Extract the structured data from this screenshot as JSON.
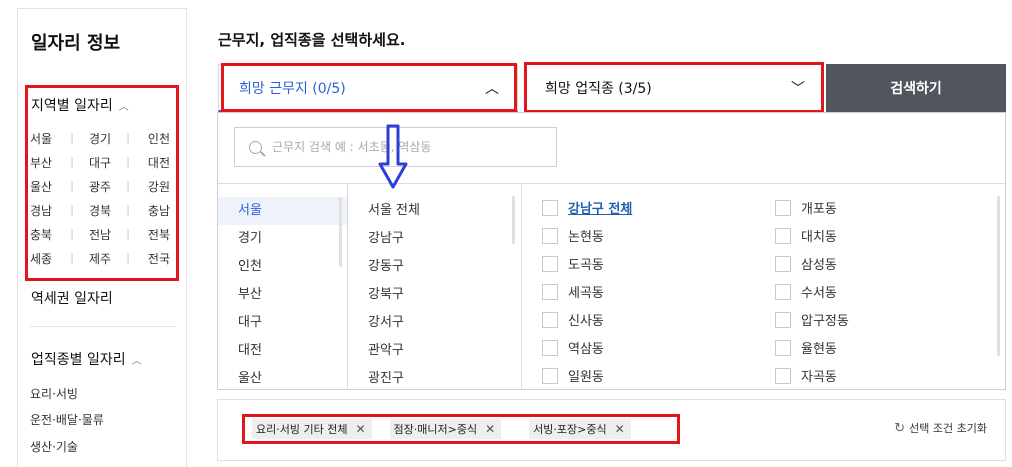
{
  "sidebar": {
    "title": "일자리 정보",
    "region_heading": "지역별 일자리",
    "regions": [
      [
        "서울",
        "경기",
        "인천"
      ],
      [
        "부산",
        "대구",
        "대전"
      ],
      [
        "울산",
        "광주",
        "강원"
      ],
      [
        "경남",
        "경북",
        "충남"
      ],
      [
        "충북",
        "전남",
        "전북"
      ],
      [
        "세종",
        "제주",
        "전국"
      ]
    ],
    "station_heading": "역세권 일자리",
    "job_heading": "업직종별 일자리",
    "job_items": [
      "요리·서빙",
      "운전·배달·물류",
      "생산·기술"
    ]
  },
  "main": {
    "title": "근무지, 업직종을 선택하세요.",
    "location_select": "희망 근무지 (0/5)",
    "job_select": "희망 업직종 (3/5)",
    "search_button": "검색하기",
    "search_placeholder": "근무지 검색 예 : 서초동, 역삼동",
    "cities": [
      "서울",
      "경기",
      "인천",
      "부산",
      "대구",
      "대전",
      "울산"
    ],
    "districts": [
      "서울 전체",
      "강남구",
      "강동구",
      "강북구",
      "강서구",
      "관악구",
      "광진구"
    ],
    "dongs_left": [
      "강남구 전체",
      "논현동",
      "도곡동",
      "세곡동",
      "신사동",
      "역삼동",
      "일원동"
    ],
    "dongs_right": [
      "개포동",
      "대치동",
      "삼성동",
      "수서동",
      "압구정동",
      "율현동",
      "자곡동"
    ]
  },
  "chips": [
    "요리·서빙 기타 전체",
    "점장·매니저>중식",
    "서빙·포장>중식"
  ],
  "reset_label": "선택 조건 초기화",
  "colors": {
    "accent": "#2d5fd8",
    "annotation_red": "#e2141c",
    "search_button_bg": "#51555e"
  }
}
